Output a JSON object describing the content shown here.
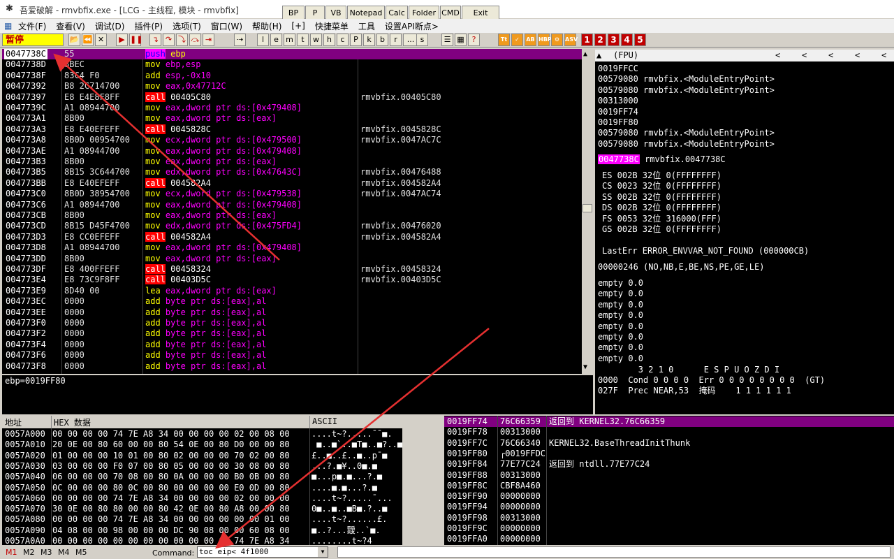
{
  "window": {
    "title": "吾爱破解 - rmvbfix.exe - [LCG - 主线程, 模块 - rmvbfix]",
    "app_icon": "spider-icon"
  },
  "quick_buttons": [
    "BP",
    "P",
    "VB",
    "Notepad",
    "Calc",
    "Folder",
    "CMD",
    "Exit"
  ],
  "menu": [
    "文件(F)",
    "查看(V)",
    "调试(D)",
    "插件(P)",
    "选项(T)",
    "窗口(W)",
    "帮助(H)",
    "[+]",
    "快捷菜单",
    "工具",
    "设置API断点>"
  ],
  "toolbar": {
    "status": "暂停",
    "buttons": [
      "open-icon",
      "rewind-icon",
      "close-icon",
      "run-icon",
      "pause-icon",
      "step-into-icon",
      "step-over-icon",
      "trace-into-icon",
      "trace-over-icon",
      "execute-till-return-icon",
      "goto-icon"
    ],
    "letters": [
      "l",
      "e",
      "m",
      "t",
      "w",
      "h",
      "c",
      "P",
      "k",
      "b",
      "r",
      "...",
      "s"
    ],
    "extra": [
      "list-icon",
      "grid-icon",
      "help-icon"
    ],
    "plugins": [
      "Tt",
      "✓",
      "AB",
      "HBP",
      "⚙",
      "ASV"
    ],
    "numbered": [
      "1",
      "2",
      "3",
      "4",
      "5"
    ]
  },
  "disasm": [
    {
      "addr": "0047738C",
      "hex": "55",
      "mnem": "push",
      "ops": "ebp",
      "comment": "",
      "sel": true
    },
    {
      "addr": "0047738D",
      "hex": "8BEC",
      "mnem": "mov",
      "ops": "ebp,esp",
      "comment": ""
    },
    {
      "addr": "0047738F",
      "hex": "83C4 F0",
      "mnem": "add",
      "ops": "esp,-0x10",
      "comment": ""
    },
    {
      "addr": "00477392",
      "hex": "B8 2C714700",
      "mnem": "mov",
      "ops": "eax,0x47712C",
      "comment": ""
    },
    {
      "addr": "00477397",
      "hex": "E8 E4E8F8FF",
      "mnem": "call",
      "ops": "00405C80",
      "comment": "rmvbfix.00405C80"
    },
    {
      "addr": "0047739C",
      "hex": "A1 08944700",
      "mnem": "mov",
      "ops": "eax,dword ptr ds:[0x479408]",
      "comment": ""
    },
    {
      "addr": "004773A1",
      "hex": "8B00",
      "mnem": "mov",
      "ops": "eax,dword ptr ds:[eax]",
      "comment": ""
    },
    {
      "addr": "004773A3",
      "hex": "E8 E40EFEFF",
      "mnem": "call",
      "ops": "0045828C",
      "comment": "rmvbfix.0045828C"
    },
    {
      "addr": "004773A8",
      "hex": "8B0D 00954700",
      "mnem": "mov",
      "ops": "ecx,dword ptr ds:[0x479500]",
      "comment": "rmvbfix.0047AC7C"
    },
    {
      "addr": "004773AE",
      "hex": "A1 08944700",
      "mnem": "mov",
      "ops": "eax,dword ptr ds:[0x479408]",
      "comment": ""
    },
    {
      "addr": "004773B3",
      "hex": "8B00",
      "mnem": "mov",
      "ops": "eax,dword ptr ds:[eax]",
      "comment": ""
    },
    {
      "addr": "004773B5",
      "hex": "8B15 3C644700",
      "mnem": "mov",
      "ops": "edx,dword ptr ds:[0x47643C]",
      "comment": "rmvbfix.00476488"
    },
    {
      "addr": "004773BB",
      "hex": "E8 E40EFEFF",
      "mnem": "call",
      "ops": "004582A4",
      "comment": "rmvbfix.004582A4"
    },
    {
      "addr": "004773C0",
      "hex": "8B0D 38954700",
      "mnem": "mov",
      "ops": "ecx,dword ptr ds:[0x479538]",
      "comment": "rmvbfix.0047AC74"
    },
    {
      "addr": "004773C6",
      "hex": "A1 08944700",
      "mnem": "mov",
      "ops": "eax,dword ptr ds:[0x479408]",
      "comment": ""
    },
    {
      "addr": "004773CB",
      "hex": "8B00",
      "mnem": "mov",
      "ops": "eax,dword ptr ds:[eax]",
      "comment": ""
    },
    {
      "addr": "004773CD",
      "hex": "8B15 D45F4700",
      "mnem": "mov",
      "ops": "edx,dword ptr ds:[0x475FD4]",
      "comment": "rmvbfix.00476020"
    },
    {
      "addr": "004773D3",
      "hex": "E8 CC0EFEFF",
      "mnem": "call",
      "ops": "004582A4",
      "comment": "rmvbfix.004582A4"
    },
    {
      "addr": "004773D8",
      "hex": "A1 08944700",
      "mnem": "mov",
      "ops": "eax,dword ptr ds:[0x479408]",
      "comment": ""
    },
    {
      "addr": "004773DD",
      "hex": "8B00",
      "mnem": "mov",
      "ops": "eax,dword ptr ds:[eax]",
      "comment": ""
    },
    {
      "addr": "004773DF",
      "hex": "E8 400FFEFF",
      "mnem": "call",
      "ops": "00458324",
      "comment": "rmvbfix.00458324"
    },
    {
      "addr": "004773E4",
      "hex": "E8 73C9F8FF",
      "mnem": "call",
      "ops": "00403D5C",
      "comment": "rmvbfix.00403D5C"
    },
    {
      "addr": "004773E9",
      "hex": "8D40 00",
      "mnem": "lea",
      "ops": "eax,dword ptr ds:[eax]",
      "comment": ""
    },
    {
      "addr": "004773EC",
      "hex": "0000",
      "mnem": "add",
      "ops": "byte ptr ds:[eax],al",
      "comment": ""
    },
    {
      "addr": "004773EE",
      "hex": "0000",
      "mnem": "add",
      "ops": "byte ptr ds:[eax],al",
      "comment": ""
    },
    {
      "addr": "004773F0",
      "hex": "0000",
      "mnem": "add",
      "ops": "byte ptr ds:[eax],al",
      "comment": ""
    },
    {
      "addr": "004773F2",
      "hex": "0000",
      "mnem": "add",
      "ops": "byte ptr ds:[eax],al",
      "comment": ""
    },
    {
      "addr": "004773F4",
      "hex": "0000",
      "mnem": "add",
      "ops": "byte ptr ds:[eax],al",
      "comment": ""
    },
    {
      "addr": "004773F6",
      "hex": "0000",
      "mnem": "add",
      "ops": "byte ptr ds:[eax],al",
      "comment": ""
    },
    {
      "addr": "004773F8",
      "hex": "0000",
      "mnem": "add",
      "ops": "byte ptr ds:[eax],al",
      "comment": ""
    }
  ],
  "info": "ebp=0019FF80",
  "registers": {
    "header": "(FPU)",
    "nav": [
      "<",
      "<",
      "<",
      "<",
      "<"
    ],
    "top_lines": [
      "0019FFCC",
      "00579080 rmvbfix.<ModuleEntryPoint>",
      "00579080 rmvbfix.<ModuleEntryPoint>",
      "00313000",
      "0019FF74",
      "0019FF80",
      "00579080 rmvbfix.<ModuleEntryPoint>",
      "00579080 rmvbfix.<ModuleEntryPoint>"
    ],
    "eip_value": "0047738C",
    "eip_comment": "rmvbfix.0047738C",
    "segments": [
      "ES 002B 32位 0(FFFFFFFF)",
      "CS 0023 32位 0(FFFFFFFF)",
      "SS 002B 32位 0(FFFFFFFF)",
      "DS 002B 32位 0(FFFFFFFF)",
      "FS 0053 32位 316000(FFF)",
      "GS 002B 32位 0(FFFFFFFF)"
    ],
    "lasterr": "LastErr ERROR_ENVVAR_NOT_FOUND (000000CB)",
    "eflags": "00000246 (NO,NB,E,BE,NS,PE,GE,LE)",
    "fpu": [
      "empty 0.0",
      "empty 0.0",
      "empty 0.0",
      "empty 0.0",
      "empty 0.0",
      "empty 0.0",
      "empty 0.0",
      "empty 0.0"
    ],
    "fpu_bits_header": "        3 2 1 0      E S P U O Z D I",
    "fpu_cond": "0000  Cond 0 0 0 0  Err 0 0 0 0 0 0 0 0  (GT)",
    "fpu_prec": "027F  Prec NEAR,53  掩码    1 1 1 1 1 1"
  },
  "dump": {
    "headers": [
      "地址",
      "HEX 数据",
      "ASCII"
    ],
    "rows": [
      {
        "addr": "0057A000",
        "hex": "00 00 00 00 74 7E A8 34 00 00 00 00 02 00 08 00",
        "ascii": "....t~?.....¯¯■."
      },
      {
        "addr": "0057A010",
        "hex": "20 0E 00 80 60 00 00 80 54 0E 00 80 D0 00 00 80",
        "ascii": " ■..■`..■T■..■?..■"
      },
      {
        "addr": "0057A020",
        "hex": "01 00 00 00 10 01 00 80 02 00 00 00 70 02 00 80",
        "ascii": "£..■..£..■..p¯■"
      },
      {
        "addr": "0057A030",
        "hex": "03 00 00 00 F0 07 00 80 05 00 00 00 30 08 00 80",
        "ascii": "...?.■¥..0■.■"
      },
      {
        "addr": "0057A040",
        "hex": "06 00 00 00 70 08 00 80 0A 00 00 00 B0 0B 00 80",
        "ascii": "■...p■.■...?.■"
      },
      {
        "addr": "0057A050",
        "hex": "0C 00 00 00 80 0C 00 80 00 00 00 00 E0 0D 00 80",
        "ascii": "....■.■...?.■"
      },
      {
        "addr": "0057A060",
        "hex": "00 00 00 00 74 7E A8 34 00 00 00 00 02 00 00 00",
        "ascii": "....t~?.....¯..."
      },
      {
        "addr": "0057A070",
        "hex": "30 0E 00 80 80 00 00 80 42 0E 00 80 A8 00 00 80",
        "ascii": "0■..■..■B■.?..■"
      },
      {
        "addr": "0057A080",
        "hex": "00 00 00 00 74 7E A8 34 00 00 00 00 00 00 01 00",
        "ascii": "....t~?......£."
      },
      {
        "addr": "0057A090",
        "hex": "04 08 00 00 98 00 00 00 DC 90 08 00 00 60 08 00",
        "ascii": "■..?...靉..`■."
      },
      {
        "addr": "0057A0A0",
        "hex": "00 00 00 00 00 00 00 00 00 00 00 00 74 7E A8 34",
        "ascii": "........t~?4"
      }
    ]
  },
  "stack": [
    {
      "addr": "0019FF74",
      "val": "76C66359",
      "com": "返回到 KERNEL32.76C66359",
      "sel": true
    },
    {
      "addr": "0019FF78",
      "val": "00313000",
      "com": ""
    },
    {
      "addr": "0019FF7C",
      "val": "76C66340",
      "com": "KERNEL32.BaseThreadInitThunk"
    },
    {
      "addr": "0019FF80",
      "val": "┌0019FFDC",
      "com": ""
    },
    {
      "addr": "0019FF84",
      "val": "77E77C24",
      "com": "返回到 ntdll.77E77C24"
    },
    {
      "addr": "0019FF88",
      "val": "00313000",
      "com": ""
    },
    {
      "addr": "0019FF8C",
      "val": "CBF8A460",
      "com": ""
    },
    {
      "addr": "0019FF90",
      "val": "00000000",
      "com": ""
    },
    {
      "addr": "0019FF94",
      "val": "00000000",
      "com": ""
    },
    {
      "addr": "0019FF98",
      "val": "00313000",
      "com": ""
    },
    {
      "addr": "0019FF9C",
      "val": "00000000",
      "com": ""
    },
    {
      "addr": "0019FFA0",
      "val": "00000000",
      "com": ""
    }
  ],
  "bottom": {
    "tabs": [
      "M1",
      "M2",
      "M3",
      "M4",
      "M5"
    ],
    "command_label": "Command:",
    "command_value": "toc eip< 4f1000"
  },
  "colors": {
    "accent_purple": "#800080",
    "call_red": "#ff0000",
    "mnemonic_yellow": "#ffff00",
    "operand_magenta": "#ff00ff",
    "arrow_red": "#e53030"
  }
}
